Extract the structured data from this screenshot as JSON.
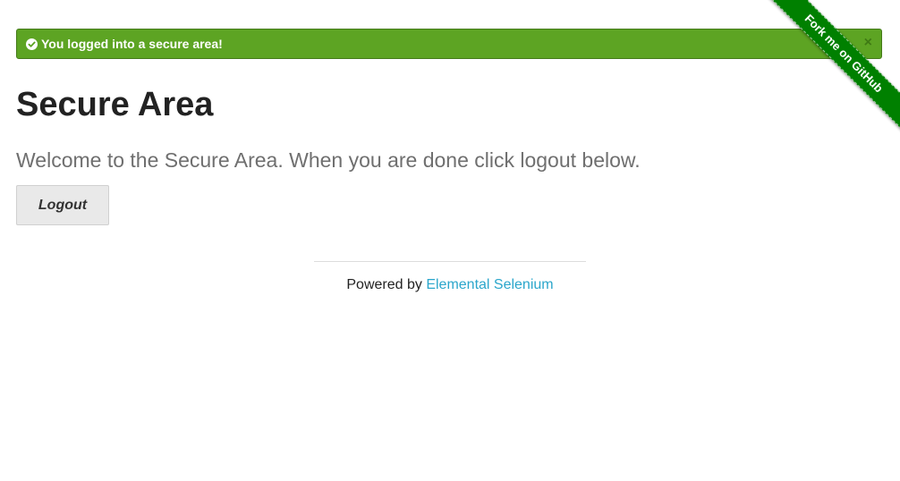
{
  "flash": {
    "message": "You logged into a secure area!",
    "close_label": "×",
    "icon": "check-circle-icon",
    "color": "#5da423"
  },
  "page": {
    "title": "Secure Area",
    "subheader": "Welcome to the Secure Area. When you are done click logout below."
  },
  "logout": {
    "label": "Logout"
  },
  "footer": {
    "prefix": "Powered by ",
    "link_text": "Elemental Selenium",
    "link_color": "#2ba6cb"
  },
  "ribbon": {
    "label": "Fork me on GitHub",
    "color": "#008000"
  }
}
